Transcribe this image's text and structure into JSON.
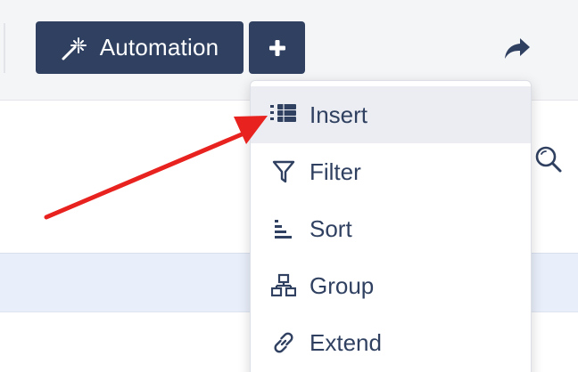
{
  "toolbar": {
    "automation_label": "Automation",
    "plus_icon": "plus-icon",
    "share_icon": "share-arrow-icon",
    "wand_icon": "magic-wand-icon"
  },
  "content": {
    "search_icon": "search-icon"
  },
  "menu": {
    "items": [
      {
        "label": "Insert",
        "icon": "insert-rows-icon",
        "active": true
      },
      {
        "label": "Filter",
        "icon": "filter-funnel-icon",
        "active": false
      },
      {
        "label": "Sort",
        "icon": "sort-icon",
        "active": false
      },
      {
        "label": "Group",
        "icon": "group-hierarchy-icon",
        "active": false
      },
      {
        "label": "Extend",
        "icon": "link-chain-icon",
        "active": false
      }
    ]
  },
  "colors": {
    "button_bg": "#2f4060",
    "menu_text": "#2f4060",
    "highlight_row": "#e9effa",
    "annotation_arrow": "#e8221e"
  }
}
